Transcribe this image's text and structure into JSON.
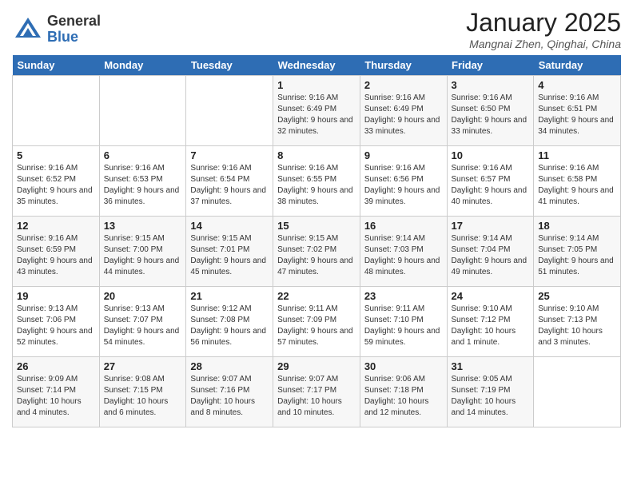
{
  "header": {
    "logo_general": "General",
    "logo_blue": "Blue",
    "month_title": "January 2025",
    "location": "Mangnai Zhen, Qinghai, China"
  },
  "days_of_week": [
    "Sunday",
    "Monday",
    "Tuesday",
    "Wednesday",
    "Thursday",
    "Friday",
    "Saturday"
  ],
  "weeks": [
    [
      {
        "num": "",
        "info": ""
      },
      {
        "num": "",
        "info": ""
      },
      {
        "num": "",
        "info": ""
      },
      {
        "num": "1",
        "info": "Sunrise: 9:16 AM\nSunset: 6:49 PM\nDaylight: 9 hours and 32 minutes."
      },
      {
        "num": "2",
        "info": "Sunrise: 9:16 AM\nSunset: 6:49 PM\nDaylight: 9 hours and 33 minutes."
      },
      {
        "num": "3",
        "info": "Sunrise: 9:16 AM\nSunset: 6:50 PM\nDaylight: 9 hours and 33 minutes."
      },
      {
        "num": "4",
        "info": "Sunrise: 9:16 AM\nSunset: 6:51 PM\nDaylight: 9 hours and 34 minutes."
      }
    ],
    [
      {
        "num": "5",
        "info": "Sunrise: 9:16 AM\nSunset: 6:52 PM\nDaylight: 9 hours and 35 minutes."
      },
      {
        "num": "6",
        "info": "Sunrise: 9:16 AM\nSunset: 6:53 PM\nDaylight: 9 hours and 36 minutes."
      },
      {
        "num": "7",
        "info": "Sunrise: 9:16 AM\nSunset: 6:54 PM\nDaylight: 9 hours and 37 minutes."
      },
      {
        "num": "8",
        "info": "Sunrise: 9:16 AM\nSunset: 6:55 PM\nDaylight: 9 hours and 38 minutes."
      },
      {
        "num": "9",
        "info": "Sunrise: 9:16 AM\nSunset: 6:56 PM\nDaylight: 9 hours and 39 minutes."
      },
      {
        "num": "10",
        "info": "Sunrise: 9:16 AM\nSunset: 6:57 PM\nDaylight: 9 hours and 40 minutes."
      },
      {
        "num": "11",
        "info": "Sunrise: 9:16 AM\nSunset: 6:58 PM\nDaylight: 9 hours and 41 minutes."
      }
    ],
    [
      {
        "num": "12",
        "info": "Sunrise: 9:16 AM\nSunset: 6:59 PM\nDaylight: 9 hours and 43 minutes."
      },
      {
        "num": "13",
        "info": "Sunrise: 9:15 AM\nSunset: 7:00 PM\nDaylight: 9 hours and 44 minutes."
      },
      {
        "num": "14",
        "info": "Sunrise: 9:15 AM\nSunset: 7:01 PM\nDaylight: 9 hours and 45 minutes."
      },
      {
        "num": "15",
        "info": "Sunrise: 9:15 AM\nSunset: 7:02 PM\nDaylight: 9 hours and 47 minutes."
      },
      {
        "num": "16",
        "info": "Sunrise: 9:14 AM\nSunset: 7:03 PM\nDaylight: 9 hours and 48 minutes."
      },
      {
        "num": "17",
        "info": "Sunrise: 9:14 AM\nSunset: 7:04 PM\nDaylight: 9 hours and 49 minutes."
      },
      {
        "num": "18",
        "info": "Sunrise: 9:14 AM\nSunset: 7:05 PM\nDaylight: 9 hours and 51 minutes."
      }
    ],
    [
      {
        "num": "19",
        "info": "Sunrise: 9:13 AM\nSunset: 7:06 PM\nDaylight: 9 hours and 52 minutes."
      },
      {
        "num": "20",
        "info": "Sunrise: 9:13 AM\nSunset: 7:07 PM\nDaylight: 9 hours and 54 minutes."
      },
      {
        "num": "21",
        "info": "Sunrise: 9:12 AM\nSunset: 7:08 PM\nDaylight: 9 hours and 56 minutes."
      },
      {
        "num": "22",
        "info": "Sunrise: 9:11 AM\nSunset: 7:09 PM\nDaylight: 9 hours and 57 minutes."
      },
      {
        "num": "23",
        "info": "Sunrise: 9:11 AM\nSunset: 7:10 PM\nDaylight: 9 hours and 59 minutes."
      },
      {
        "num": "24",
        "info": "Sunrise: 9:10 AM\nSunset: 7:12 PM\nDaylight: 10 hours and 1 minute."
      },
      {
        "num": "25",
        "info": "Sunrise: 9:10 AM\nSunset: 7:13 PM\nDaylight: 10 hours and 3 minutes."
      }
    ],
    [
      {
        "num": "26",
        "info": "Sunrise: 9:09 AM\nSunset: 7:14 PM\nDaylight: 10 hours and 4 minutes."
      },
      {
        "num": "27",
        "info": "Sunrise: 9:08 AM\nSunset: 7:15 PM\nDaylight: 10 hours and 6 minutes."
      },
      {
        "num": "28",
        "info": "Sunrise: 9:07 AM\nSunset: 7:16 PM\nDaylight: 10 hours and 8 minutes."
      },
      {
        "num": "29",
        "info": "Sunrise: 9:07 AM\nSunset: 7:17 PM\nDaylight: 10 hours and 10 minutes."
      },
      {
        "num": "30",
        "info": "Sunrise: 9:06 AM\nSunset: 7:18 PM\nDaylight: 10 hours and 12 minutes."
      },
      {
        "num": "31",
        "info": "Sunrise: 9:05 AM\nSunset: 7:19 PM\nDaylight: 10 hours and 14 minutes."
      },
      {
        "num": "",
        "info": ""
      }
    ]
  ]
}
